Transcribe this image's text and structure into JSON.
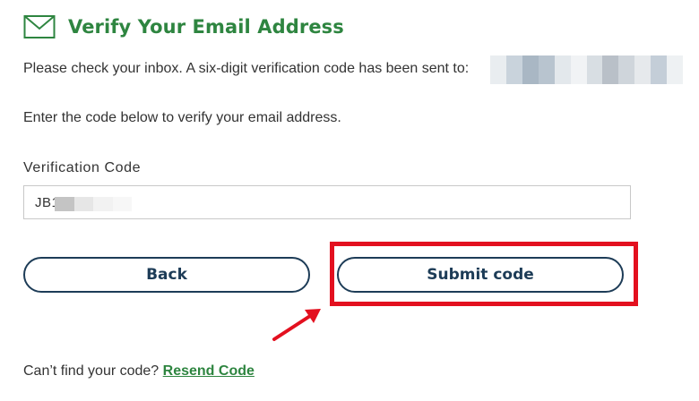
{
  "header": {
    "title": "Verify Your Email Address",
    "icon": "envelope-icon",
    "accent": "#2e8540"
  },
  "message": {
    "sent_notice": "Please check your inbox. A six-digit verification code has been sent to:",
    "instruction": "Enter the code below to verify your email address."
  },
  "form": {
    "code_label": "Verification Code",
    "code_value": "JB1"
  },
  "buttons": {
    "back_label": "Back",
    "submit_label": "Submit code"
  },
  "footer": {
    "prompt": "Can’t find your code?",
    "resend_label": "Resend Code"
  },
  "colors": {
    "primary": "#1d3c57",
    "link": "#2e8540",
    "highlight": "#e3101f"
  }
}
